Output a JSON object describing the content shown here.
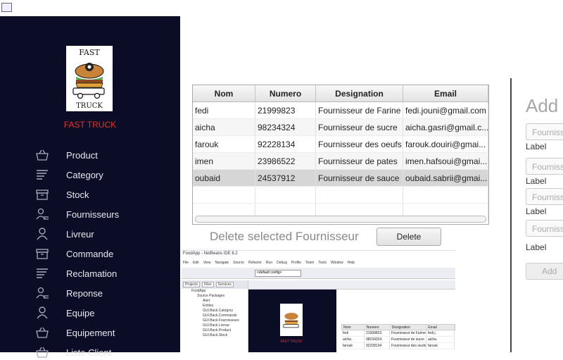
{
  "brand": {
    "name": "FAST TRUCK",
    "accent": "#e53030",
    "sidebar_bg": "#0b0d26"
  },
  "nav": [
    {
      "label": "Product",
      "icon": "basket-icon"
    },
    {
      "label": "Category",
      "icon": "list-lines-icon"
    },
    {
      "label": "Stock",
      "icon": "archive-box-icon"
    },
    {
      "label": "Fournisseurs",
      "icon": "supplier-person-icon"
    },
    {
      "label": "Livreur",
      "icon": "person-icon"
    },
    {
      "label": "Commande",
      "icon": "archive-box-icon"
    },
    {
      "label": "Reclamation",
      "icon": "list-lines-icon"
    },
    {
      "label": "Reponse",
      "icon": "supplier-person-icon"
    },
    {
      "label": "Equipe",
      "icon": "person-icon"
    },
    {
      "label": "Equipement",
      "icon": "basket-icon"
    },
    {
      "label": "Liste Client",
      "icon": "basket-icon"
    }
  ],
  "table": {
    "columns": [
      "Nom",
      "Numero",
      "Designation",
      "Email"
    ],
    "rows": [
      [
        "fedi",
        "21999823",
        "Fournisseur de Farine",
        "fedi.jouni@gmail.com"
      ],
      [
        "aicha",
        "98234324",
        "Fournisseur de sucre",
        "aicha.gasri@gmail.c..."
      ],
      [
        "farouk",
        "92228134",
        "Fournisseur des oeufs",
        "farouk.douiri@gmai..."
      ],
      [
        "imen",
        "23986522",
        "Fournisseur de pates",
        "imen.hafsoui@gmai..."
      ],
      [
        "oubaid",
        "24537912",
        "Fournisseur de sauce",
        "oubaid.sabrii@gmai..."
      ]
    ],
    "selected_row": 4
  },
  "delete": {
    "label": "Delete selected Fournisseur",
    "button": "Delete"
  },
  "add_form": {
    "title": "Add",
    "placeholder": "Fournisseur",
    "field_label": "Label",
    "button": "Add"
  },
  "embedded_screenshot": {
    "title": "FoodApp - NetBeans IDE 8.2",
    "menu": [
      "File",
      "Edit",
      "View",
      "Navigate",
      "Source",
      "Refactor",
      "Run",
      "Debug",
      "Profile",
      "Team",
      "Tools",
      "Window",
      "Help"
    ],
    "config": "<default config>",
    "panel_tabs": [
      "Projects",
      "Files",
      "Services"
    ],
    "tree": [
      "FoodApp",
      "Source Packages",
      "Alert",
      "Entites",
      "GUI.Back.Category",
      "GUI.Back.Commande",
      "GUI.Back.Fournisseurs",
      "GUI.Back.Livreur",
      "GUI.Back.Product",
      "GUI.Back.Stock"
    ],
    "brand": "FAST TRUCK",
    "table_columns": [
      "Nom",
      "Numero",
      "Designation",
      "Email"
    ],
    "table_rows": [
      [
        "fedi",
        "21999823",
        "Fournisseur de Farine",
        "fedi.j"
      ],
      [
        "aicha",
        "98234324",
        "Fournisseur de sucre",
        "aicha."
      ],
      [
        "farouk",
        "92228134",
        "Fournisseur des oeufs",
        "farouk"
      ]
    ]
  }
}
